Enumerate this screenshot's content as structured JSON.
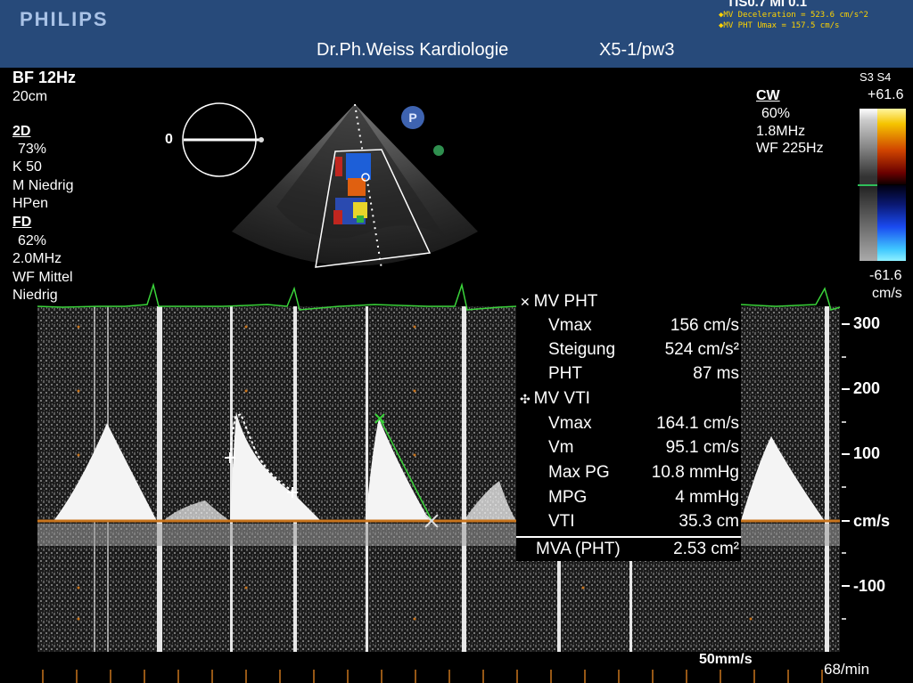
{
  "header": {
    "brand": "PHILIPS",
    "title": "Dr.Ph.Weiss Kardiologie",
    "probe": "X5-1/pw3",
    "top_right": "TIS0.7 MI 0.1",
    "measurements": [
      "MV Deceleration = 523.6 cm/s^2",
      "MV PHT Umax = 157.5 cm/s"
    ]
  },
  "left_panel": {
    "bf": "BF 12Hz",
    "depth": "20cm",
    "mode_2d": "2D",
    "gain_2d": "73%",
    "k": "K 50",
    "m": "M Niedrig",
    "hpen": "HPen",
    "mode_fd": "FD",
    "gain_fd": "62%",
    "freq_fd": "2.0MHz",
    "wf_fd": "WF Mittel",
    "level": "Niedrig"
  },
  "angle_indicator": {
    "label": "0"
  },
  "right_panel": {
    "mode": "CW",
    "gain": "60%",
    "freq": "1.8MHz",
    "wf": "WF 225Hz",
    "scale_title": "S3 S4",
    "scale_max": "+61.6",
    "scale_min": "-61.6",
    "scale_unit": "cm/s"
  },
  "measurements_panel": {
    "group1_title": "MV PHT",
    "group1": [
      {
        "label": "Vmax",
        "value": "156 cm/s"
      },
      {
        "label": "Steigung",
        "value": "524 cm/s²"
      },
      {
        "label": "PHT",
        "value": "87 ms"
      }
    ],
    "group2_title": "MV VTI",
    "group2": [
      {
        "label": "Vmax",
        "value": "164.1 cm/s"
      },
      {
        "label": "Vm",
        "value": "95.1 cm/s"
      },
      {
        "label": "Max PG",
        "value": "10.8 mmHg"
      },
      {
        "label": "MPG",
        "value": "4 mmHg"
      },
      {
        "label": "VTI",
        "value": "35.3 cm"
      }
    ],
    "result_label": "MVA (PHT)",
    "result_value": "2.53 cm²"
  },
  "velocity_axis": {
    "labels": [
      "300",
      "200",
      "100",
      "cm/s",
      "-100"
    ]
  },
  "footer": {
    "sweep_speed": "50mm/s",
    "heart_rate": "68/min"
  },
  "colors": {
    "header_bg": "#274a7a",
    "ecg": "#3ad43a",
    "baseline": "#c8741c",
    "yellow_text": "#ffd400"
  }
}
